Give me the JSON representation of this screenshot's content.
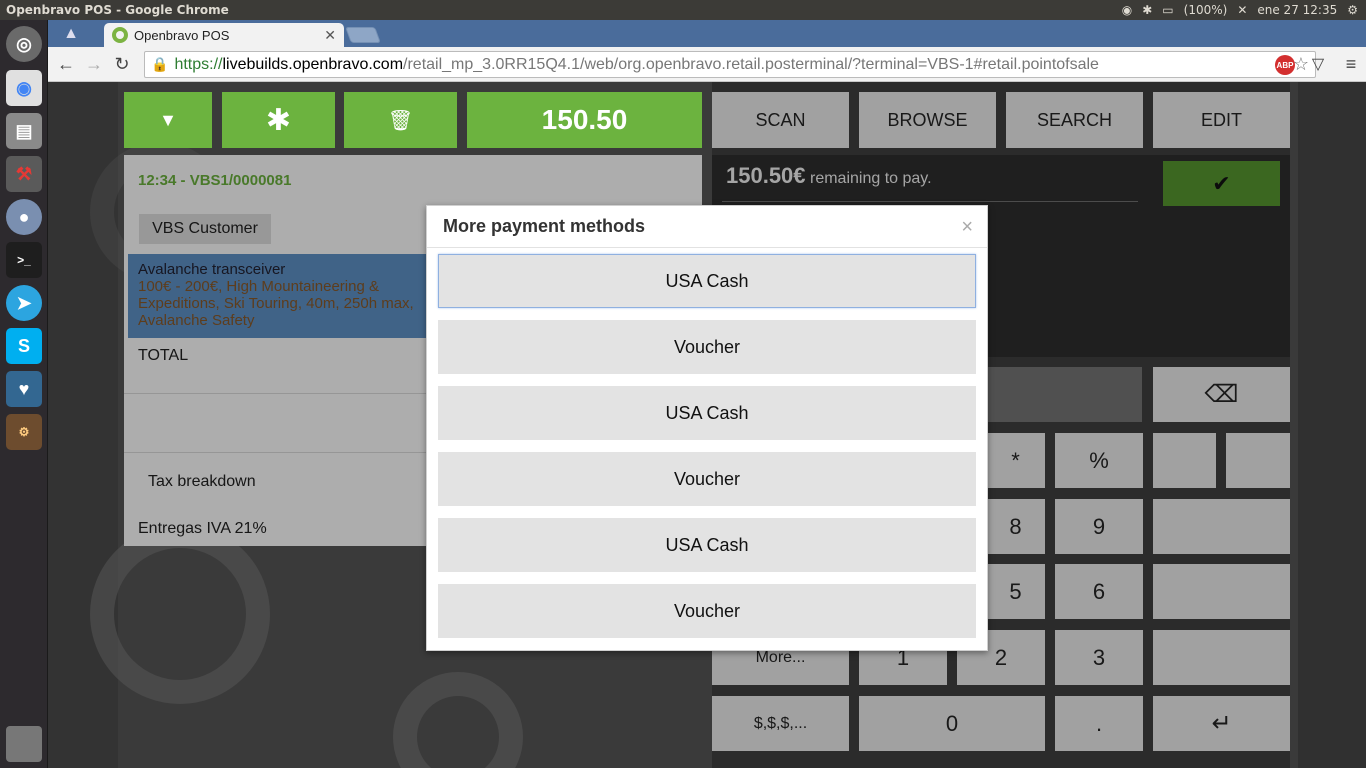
{
  "os_panel": {
    "title": "Openbravo POS - Google Chrome",
    "battery": "(100%)",
    "clock": "ene 27 12:35"
  },
  "browser": {
    "tab_title": "Openbravo POS",
    "url_scheme": "https://",
    "url_host": "livebuilds.openbravo.com",
    "url_path": "/retail_mp_3.0RR15Q4.1/web/org.openbravo.retail.posterminal/?terminal=VBS-1#retail.pointofsale",
    "abp_label": "ABP"
  },
  "pos": {
    "total_button": "150.50",
    "top_tabs": [
      "SCAN",
      "BROWSE",
      "SEARCH",
      "EDIT"
    ],
    "receipt_header": "12:34 - VBS1/0000081",
    "customer": "VBS Customer",
    "line_product": "Avalanche transceiver",
    "line_description": "100€ - 200€, High Mountaineering & Expeditions, Ski Touring, 40m, 250h max, Avalanche Safety",
    "total_label": "TOTAL",
    "tax_breakdown": "Tax breakdown",
    "tax_line": "Entregas IVA 21%",
    "remaining_amount": "150.50€",
    "remaining_text": "remaining to pay.",
    "keys": {
      "asterisk": "*",
      "percent": "%",
      "k8": "8",
      "k9": "9",
      "k5": "5",
      "k6": "6",
      "more": "More...",
      "k1": "1",
      "k2": "2",
      "k3": "3",
      "coins": "$,$,$,...",
      "k0": "0",
      "dot": "."
    }
  },
  "modal": {
    "title": "More payment methods",
    "close": "×",
    "methods": [
      "USA Cash",
      "Voucher",
      "USA Cash",
      "Voucher",
      "USA Cash",
      "Voucher"
    ]
  }
}
